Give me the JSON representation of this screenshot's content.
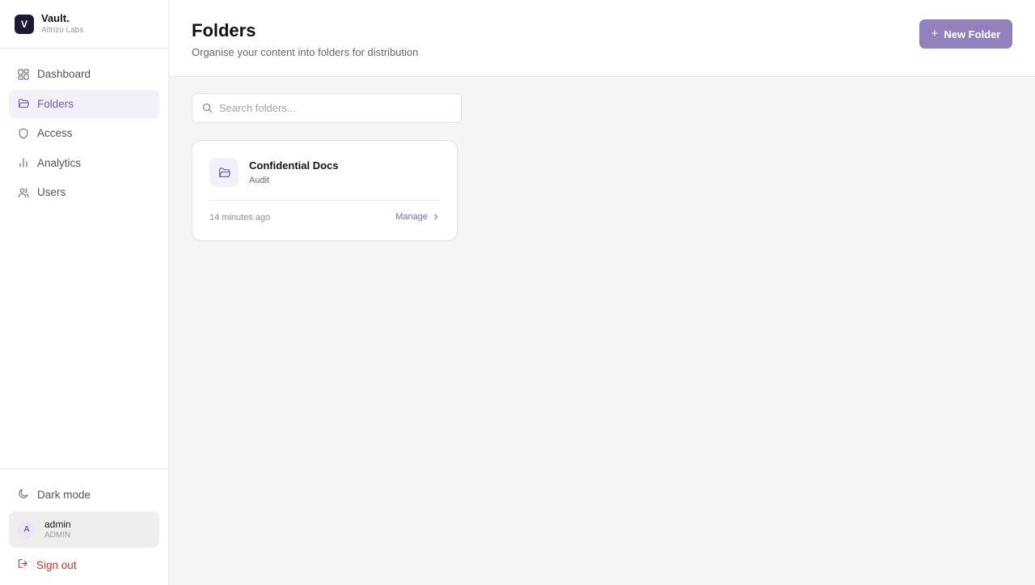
{
  "brand": {
    "logo_letter": "V",
    "name": "Vault.",
    "org": "Altrizo Labs"
  },
  "sidebar": {
    "items": [
      {
        "label": "Dashboard",
        "icon": "dashboard-icon",
        "active": false
      },
      {
        "label": "Folders",
        "icon": "folder-icon",
        "active": true
      },
      {
        "label": "Access",
        "icon": "shield-icon",
        "active": false
      },
      {
        "label": "Analytics",
        "icon": "bar-chart-icon",
        "active": false
      },
      {
        "label": "Users",
        "icon": "users-icon",
        "active": false
      }
    ],
    "dark_mode_label": "Dark mode",
    "user": {
      "initial": "A",
      "name": "admin",
      "role": "ADMIN"
    },
    "sign_out_label": "Sign out"
  },
  "header": {
    "title": "Folders",
    "subtitle": "Organise your content into folders for distribution",
    "new_button_label": "New Folder"
  },
  "search": {
    "placeholder": "Search folders...",
    "value": ""
  },
  "folders": [
    {
      "name": "Confidential Docs",
      "type": "Audit",
      "updated": "14 minutes ago",
      "action_label": "Manage"
    }
  ],
  "colors": {
    "accent": "#7a66b0",
    "accent_button": "#9381be",
    "active_nav_bg": "#f3f0fa",
    "danger": "#c0392b",
    "brand_dark": "#1f1a33"
  }
}
